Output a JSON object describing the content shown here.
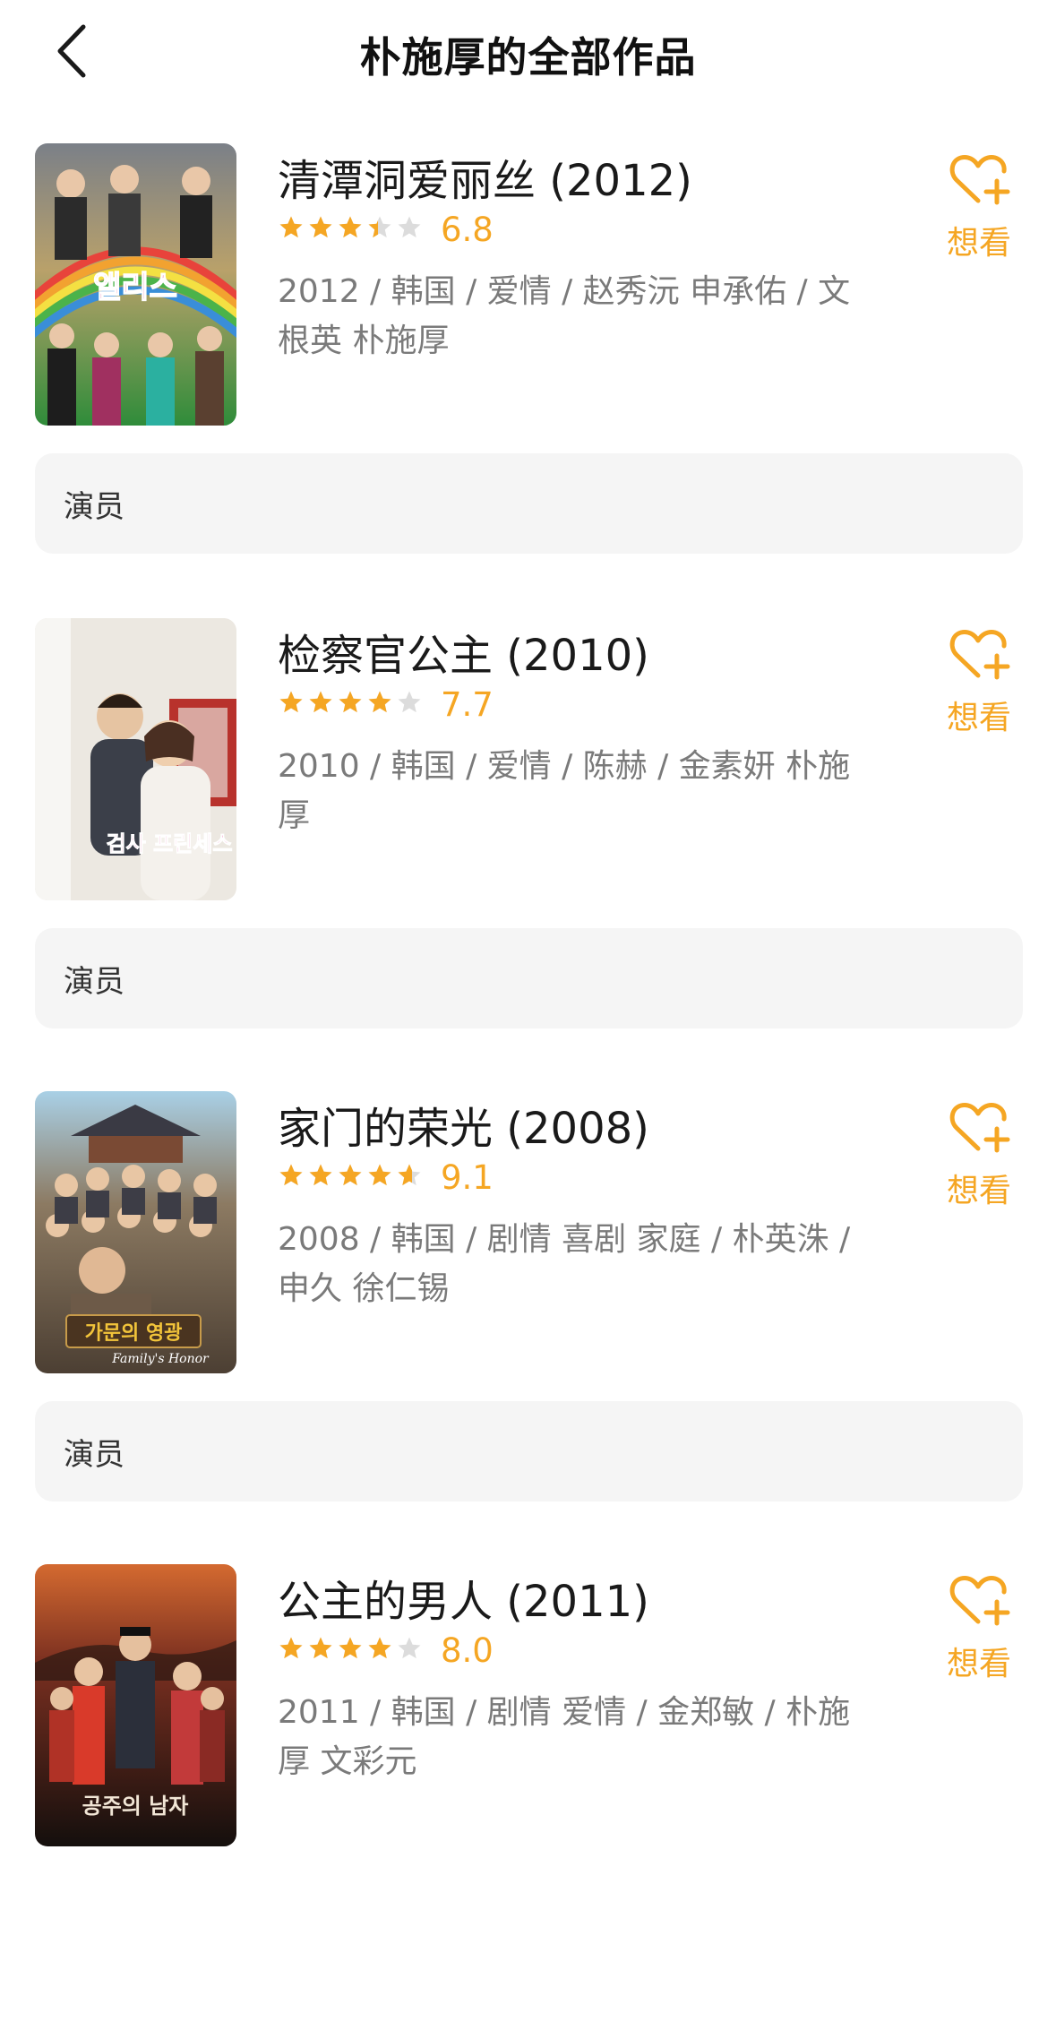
{
  "header": {
    "title": "朴施厚的全部作品"
  },
  "works": [
    {
      "title": "清潭洞爱丽丝 (2012)",
      "rating": 3.4,
      "rating_max": 5,
      "score": "6.8",
      "info": "2012 / 韩国 / 爱情 / 赵秀沅 申承佑 / 文根英 朴施厚",
      "wish_label": "想看",
      "role": "演员",
      "poster_text": "앨리스",
      "colors": {
        "poster_top": "#8a8f96",
        "poster_bottom": "#3b9a3c",
        "accent": "#e6408a"
      }
    },
    {
      "title": "检察官公主 (2010)",
      "rating": 3.85,
      "rating_max": 5,
      "score": "7.7",
      "info": "2010 / 韩国 / 爱情 / 陈赫 / 金素妍 朴施厚",
      "wish_label": "想看",
      "role": "演员",
      "poster_text": "검사 프린세스",
      "colors": {
        "poster_top": "#f3efe8",
        "poster_bottom": "#d9d4cc",
        "accent": "#e62e8c"
      }
    },
    {
      "title": "家门的荣光 (2008)",
      "rating": 4.55,
      "rating_max": 5,
      "score": "9.1",
      "info": "2008 / 韩国 / 剧情 喜剧 家庭 / 朴英洙 / 申久 徐仁锡",
      "wish_label": "想看",
      "role": "演员",
      "poster_text": "가문의 영광",
      "poster_caption": "Family's Honor",
      "colors": {
        "poster_top": "#9ec9e0",
        "poster_bottom": "#6b5a46",
        "accent": "#f2c43a"
      }
    },
    {
      "title": "公主的男人 (2011)",
      "rating": 4.0,
      "rating_max": 5,
      "score": "8.0",
      "info": "2011 / 韩国 / 剧情 爱情 / 金郑敏 / 朴施厚 文彩元",
      "wish_label": "想看",
      "role": "演员",
      "poster_text": "공주의 남자",
      "colors": {
        "poster_top": "#c75a2a",
        "poster_bottom": "#1b1412",
        "accent": "#d93a2a"
      }
    }
  ],
  "colors": {
    "accent": "#f5a623",
    "role_bg": "#f5f5f5",
    "meta_text": "#7a7a7a"
  }
}
